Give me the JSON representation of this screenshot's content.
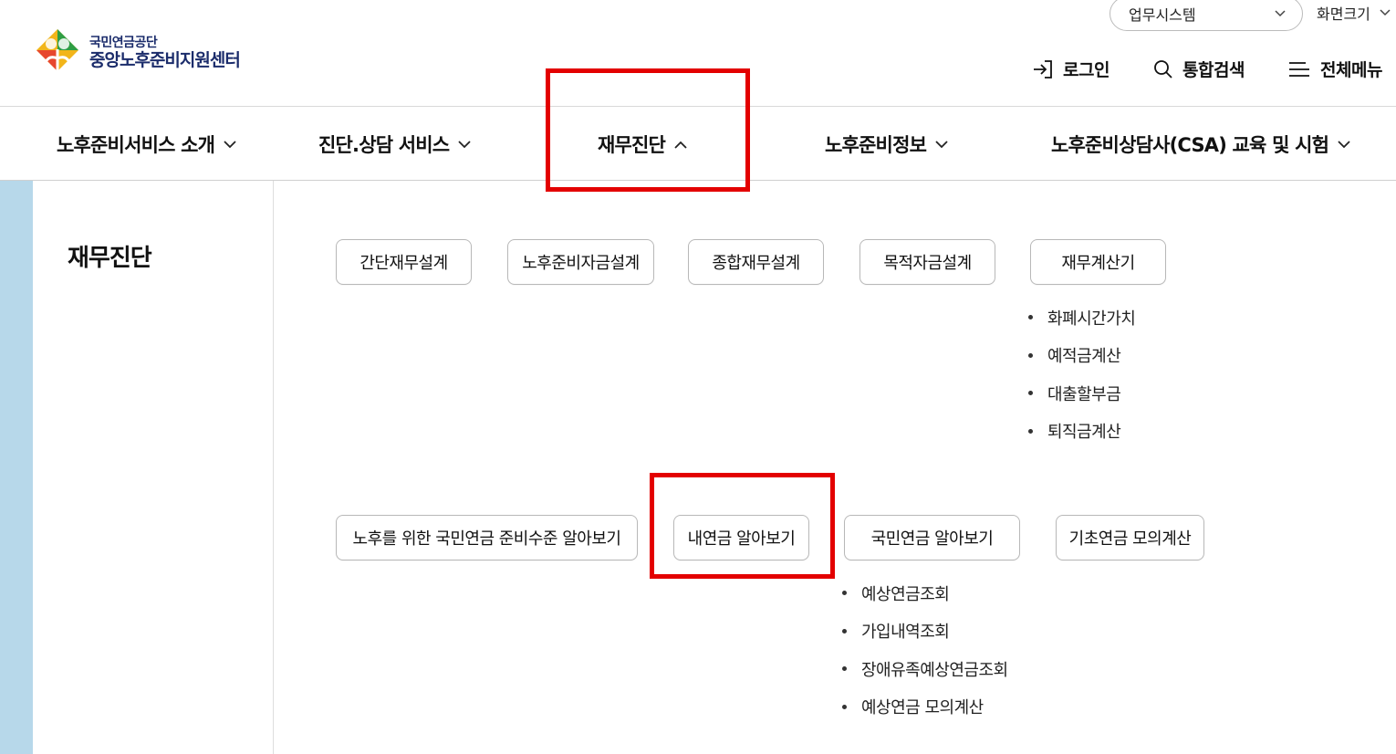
{
  "header": {
    "logo_org": "국민연금공단",
    "logo_center": "중앙노후준비지원센터",
    "biz_system_label": "업무시스템",
    "screen_size_label": "화면크기",
    "login_label": "로그인",
    "search_label": "통합검색",
    "allmenu_label": "전체메뉴"
  },
  "gnb": [
    {
      "label": "노후준비서비스 소개",
      "expanded": false
    },
    {
      "label": "진단.상담 서비스",
      "expanded": false
    },
    {
      "label": "재무진단",
      "expanded": true
    },
    {
      "label": "노후준비정보",
      "expanded": false
    },
    {
      "label": "노후준비상담사(CSA) 교육 및 시험",
      "expanded": false
    }
  ],
  "submenu": {
    "title": "재무진단",
    "row1": [
      "간단재무설계",
      "노후준비자금설계",
      "종합재무설계",
      "목적자금설계",
      "재무계산기"
    ],
    "calc_items": [
      "화폐시간가치",
      "예적금계산",
      "대출할부금",
      "퇴직금계산"
    ],
    "row2": [
      "노후를 위한 국민연금 준비수준 알아보기",
      "내연금 알아보기",
      "국민연금 알아보기",
      "기초연금 모의계산"
    ],
    "pension_items": [
      "예상연금조회",
      "가입내역조회",
      "장애유족예상연금조회",
      "예상연금 모의계산"
    ]
  },
  "colors": {
    "highlight": "#e30000",
    "side_strip": "#b7d8ea",
    "logo_text": "#1b2c6b"
  }
}
